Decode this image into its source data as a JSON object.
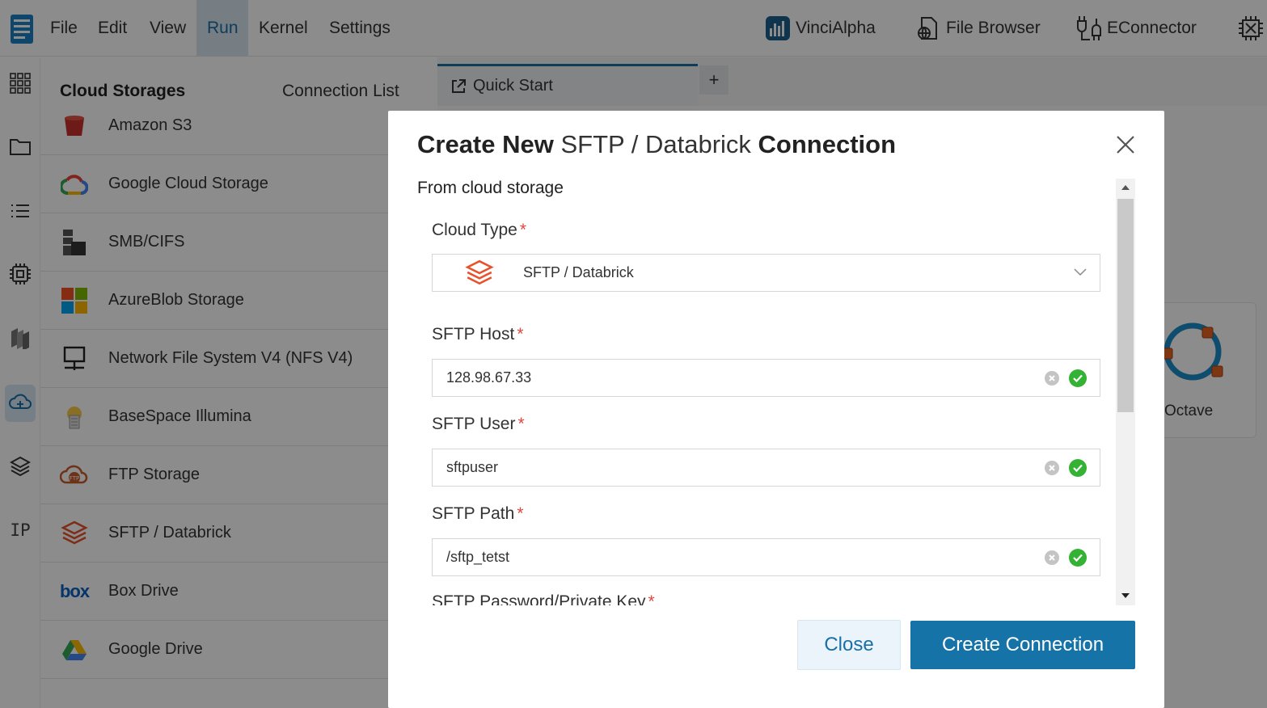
{
  "menubar": {
    "items": [
      "File",
      "Edit",
      "View",
      "Run",
      "Kernel",
      "Settings"
    ],
    "active": "Run",
    "tools": [
      {
        "label": "VinciAlpha",
        "icon": "vincialpha-icon"
      },
      {
        "label": "File Browser",
        "icon": "file-browser-icon"
      },
      {
        "label": "EConnector",
        "icon": "econnector-icon"
      }
    ]
  },
  "rail": {
    "text_item": "IP",
    "icons": [
      "grid-icon",
      "folder-icon",
      "list-icon",
      "chip-icon",
      "stack-icon",
      "cloud-storage-icon",
      "layers-icon"
    ],
    "active": "cloud-storage-icon"
  },
  "panel": {
    "title": "Cloud Storages",
    "tab": "Connection List",
    "items": [
      {
        "label": "Amazon S3",
        "icon": "amazon-s3-icon"
      },
      {
        "label": "Google Cloud Storage",
        "icon": "google-cloud-icon"
      },
      {
        "label": "SMB/CIFS",
        "icon": "smb-icon"
      },
      {
        "label": "AzureBlob Storage",
        "icon": "azure-icon"
      },
      {
        "label": "Network File System V4 (NFS V4)",
        "icon": "nfs-icon"
      },
      {
        "label": "BaseSpace Illumina",
        "icon": "basespace-icon"
      },
      {
        "label": "FTP Storage",
        "icon": "ftp-icon"
      },
      {
        "label": "SFTP / Databrick",
        "icon": "databrick-icon"
      },
      {
        "label": "Box Drive",
        "icon": "box-icon"
      },
      {
        "label": "Google Drive",
        "icon": "google-drive-icon"
      }
    ]
  },
  "tabs": {
    "active_label": "Quick Start",
    "add_label": "+"
  },
  "launcher": {
    "octave_label": "Octave"
  },
  "modal": {
    "title_bold_1": "Create New",
    "title_thin": "SFTP / Databrick",
    "title_bold_2": "Connection",
    "section": "From cloud storage",
    "fields": {
      "cloud_type_label": "Cloud Type",
      "cloud_type_value": "SFTP / Databrick",
      "host_label": "SFTP Host",
      "host_value": "128.98.67.33",
      "user_label": "SFTP User",
      "user_value": "sftpuser",
      "path_label": "SFTP Path",
      "path_value": "/sftp_tetst",
      "password_label": "SFTP Password/Private Key"
    },
    "required_mark": "*",
    "close_button": "Close",
    "create_button": "Create Connection"
  },
  "colors": {
    "accent": "#1673a8",
    "required": "#e0473e",
    "valid": "#34b233"
  }
}
